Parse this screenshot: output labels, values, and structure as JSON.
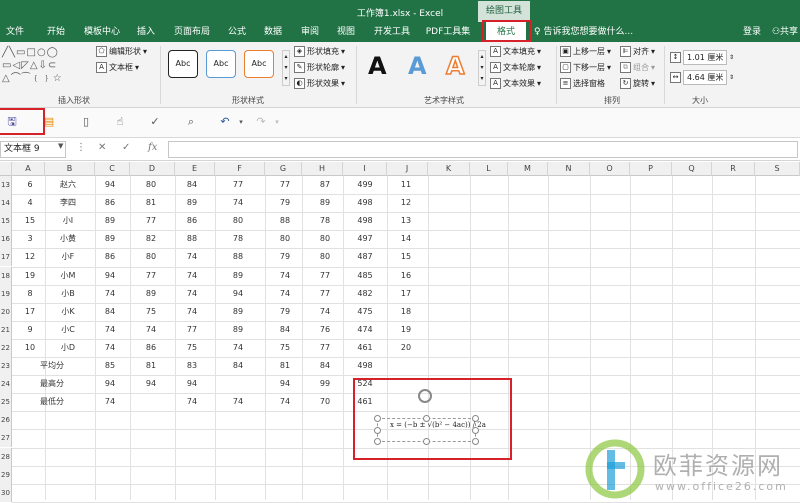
{
  "title_bar": {
    "title": "工作簿1.xlsx - Excel",
    "context_tab": "绘图工具"
  },
  "tabs": [
    {
      "label": "文件",
      "active": false
    },
    {
      "label": "开始",
      "active": false
    },
    {
      "label": "模板中心",
      "active": false
    },
    {
      "label": "插入",
      "active": false
    },
    {
      "label": "页面布局",
      "active": false
    },
    {
      "label": "公式",
      "active": false
    },
    {
      "label": "数据",
      "active": false
    },
    {
      "label": "审阅",
      "active": false
    },
    {
      "label": "视图",
      "active": false
    },
    {
      "label": "开发工具",
      "active": false
    },
    {
      "label": "PDF工具集",
      "active": false
    },
    {
      "label": "格式",
      "active": true
    }
  ],
  "tell_me": "告诉我您想要做什么...",
  "user_actions": {
    "login": "登录",
    "share": "共享"
  },
  "ribbon": {
    "insert_shapes": {
      "label": "插入形状",
      "edit_shape": "编辑形状",
      "text_box": "文本框"
    },
    "shape_styles": {
      "label": "形状样式",
      "abc": "Abc",
      "fill": "形状填充",
      "outline": "形状轮廓",
      "effects": "形状效果"
    },
    "wordart": {
      "label": "艺术字样式",
      "letter": "A",
      "text_fill": "文本填充",
      "text_outline": "文本轮廓",
      "text_effects": "文本效果"
    },
    "arrange": {
      "label": "排列",
      "bring_forward": "上移一层",
      "send_backward": "下移一层",
      "selection_pane": "选择窗格",
      "align": "对齐",
      "group": "组合",
      "rotate": "旋转"
    },
    "size": {
      "label": "大小",
      "height": "1.01 厘米",
      "width": "4.64 厘米"
    }
  },
  "name_box": "文本框 9",
  "fx_label": "fx",
  "columns": [
    "A",
    "B",
    "C",
    "D",
    "E",
    "F",
    "G",
    "H",
    "I",
    "J",
    "K",
    "L",
    "M",
    "N",
    "O",
    "P",
    "Q",
    "R",
    "S"
  ],
  "rows": [
    {
      "row": "13",
      "cells": [
        "6",
        "赵六",
        "94",
        "80",
        "84",
        "77",
        "77",
        "87",
        "499",
        "11"
      ]
    },
    {
      "row": "14",
      "cells": [
        "4",
        "李四",
        "86",
        "81",
        "89",
        "74",
        "79",
        "89",
        "498",
        "12"
      ]
    },
    {
      "row": "15",
      "cells": [
        "15",
        "小I",
        "89",
        "77",
        "86",
        "80",
        "88",
        "78",
        "498",
        "13"
      ]
    },
    {
      "row": "16",
      "cells": [
        "3",
        "小黄",
        "89",
        "82",
        "88",
        "78",
        "80",
        "80",
        "497",
        "14"
      ]
    },
    {
      "row": "17",
      "cells": [
        "12",
        "小F",
        "86",
        "80",
        "74",
        "88",
        "79",
        "80",
        "487",
        "15"
      ]
    },
    {
      "row": "18",
      "cells": [
        "19",
        "小M",
        "94",
        "77",
        "74",
        "89",
        "74",
        "77",
        "485",
        "16"
      ]
    },
    {
      "row": "19",
      "cells": [
        "8",
        "小B",
        "74",
        "89",
        "74",
        "94",
        "74",
        "77",
        "482",
        "17"
      ]
    },
    {
      "row": "20",
      "cells": [
        "17",
        "小K",
        "84",
        "75",
        "74",
        "89",
        "79",
        "74",
        "475",
        "18"
      ]
    },
    {
      "row": "21",
      "cells": [
        "9",
        "小C",
        "74",
        "74",
        "77",
        "89",
        "84",
        "76",
        "474",
        "19"
      ]
    },
    {
      "row": "22",
      "cells": [
        "10",
        "小D",
        "74",
        "86",
        "75",
        "74",
        "75",
        "77",
        "461",
        "20"
      ]
    },
    {
      "row": "23",
      "cells": [
        "",
        "平均分",
        "85",
        "81",
        "83",
        "84",
        "81",
        "84",
        "498",
        ""
      ]
    },
    {
      "row": "24",
      "cells": [
        "",
        "最高分",
        "94",
        "94",
        "94",
        "",
        "94",
        "99",
        "524",
        ""
      ]
    },
    {
      "row": "25",
      "cells": [
        "",
        "最低分",
        "74",
        "",
        "74",
        "74",
        "74",
        "70",
        "461",
        ""
      ]
    },
    {
      "row": "26",
      "cells": [
        "",
        "",
        "",
        "",
        "",
        "",
        "",
        "",
        "",
        ""
      ]
    },
    {
      "row": "27",
      "cells": [
        "",
        "",
        "",
        "",
        "",
        "",
        "",
        "",
        "",
        ""
      ]
    },
    {
      "row": "28",
      "cells": [
        "",
        "",
        "",
        "",
        "",
        "",
        "",
        "",
        "",
        ""
      ]
    },
    {
      "row": "29",
      "cells": [
        "",
        "",
        "",
        "",
        "",
        "",
        "",
        "",
        "",
        ""
      ]
    },
    {
      "row": "30",
      "cells": [
        "",
        "",
        "",
        "",
        "",
        "",
        "",
        "",
        "",
        ""
      ]
    }
  ],
  "equation": "x = (−b ± √(b² − 4ac)) / 2a",
  "watermark": {
    "text": "欧菲资源网",
    "url": "www.office26.com"
  },
  "colors": {
    "brand_green": "#217346",
    "highlight_red": "#d6212b",
    "orange_a": "#ed7d31",
    "blue_a": "#5b9bd5"
  }
}
